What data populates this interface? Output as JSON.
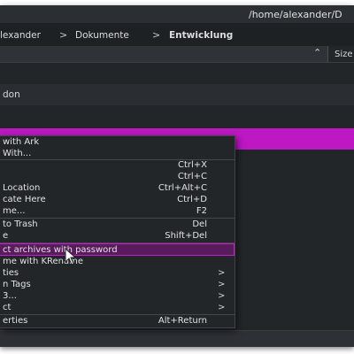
{
  "window": {
    "title": "/home/alexander/D"
  },
  "breadcrumb": [
    {
      "label": "lexander"
    },
    {
      "label": "Dokumente"
    },
    {
      "label": "Entwicklung"
    }
  ],
  "columns": {
    "size": "Size"
  },
  "files": [
    {
      "label": ""
    },
    {
      "label": "don"
    },
    {
      "label": ""
    }
  ],
  "colors": {
    "selection": "#bd18c4",
    "menu_hover": "#5b1a5e",
    "background": "#232629"
  },
  "context_menu": {
    "items": [
      {
        "label": "with Ark",
        "shortcut": "",
        "submenu": false
      },
      {
        "label": "With...",
        "shortcut": "",
        "submenu": false
      },
      {
        "label": "",
        "shortcut": "Ctrl+X",
        "submenu": false
      },
      {
        "label": "",
        "shortcut": "Ctrl+C",
        "submenu": false
      },
      {
        "label": "Location",
        "shortcut": "Ctrl+Alt+C",
        "submenu": false
      },
      {
        "label": "cate Here",
        "shortcut": "Ctrl+D",
        "submenu": false
      },
      {
        "label": "me...",
        "shortcut": "F2",
        "submenu": false
      },
      {
        "label": "to Trash",
        "shortcut": "Del",
        "submenu": false
      },
      {
        "label": "e",
        "shortcut": "Shift+Del",
        "submenu": false
      },
      {
        "label": "ct archives with password",
        "shortcut": "",
        "submenu": false
      },
      {
        "label": "me with KRename",
        "shortcut": "",
        "submenu": false
      },
      {
        "label": "ties",
        "shortcut": "",
        "submenu": true
      },
      {
        "label": "n Tags",
        "shortcut": "",
        "submenu": true
      },
      {
        "label": "3...",
        "shortcut": "",
        "submenu": true
      },
      {
        "label": "ct",
        "shortcut": "",
        "submenu": true
      },
      {
        "label": "erties",
        "shortcut": "Alt+Return",
        "submenu": false
      }
    ]
  }
}
